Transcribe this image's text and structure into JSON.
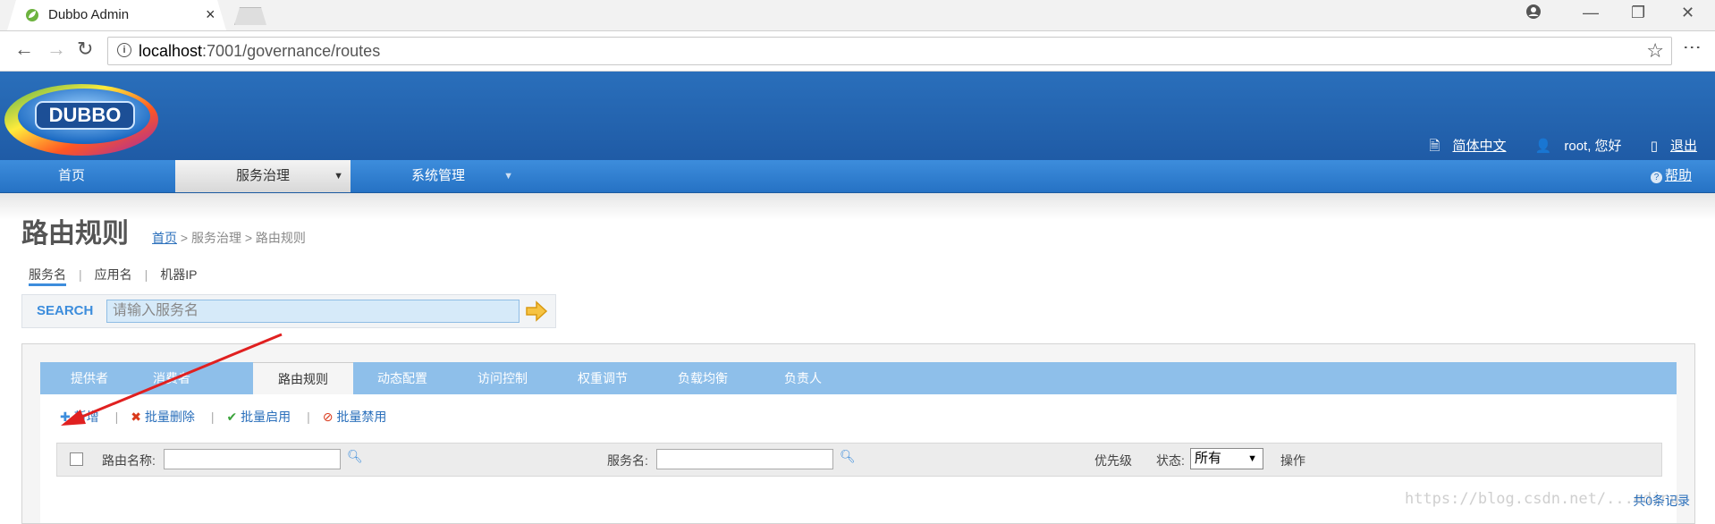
{
  "browser": {
    "tab_title": "Dubbo Admin",
    "url_host": "localhost",
    "url_rest": ":7001/governance/routes"
  },
  "header": {
    "logo_text": "DUBBO",
    "lang": "简体中文",
    "user": "root, 您好",
    "logout": "退出"
  },
  "nav": {
    "items": [
      "首页",
      "服务治理",
      "系统管理"
    ],
    "help": "帮助"
  },
  "page": {
    "title": "路由规则",
    "breadcrumb_home": "首页",
    "breadcrumb_rest": " > 服务治理 > 路由规则"
  },
  "search": {
    "tabs": [
      "服务名",
      "应用名",
      "机器IP"
    ],
    "label": "SEARCH",
    "placeholder": "请输入服务名"
  },
  "subtabs": [
    "提供者",
    "消费者",
    "路由规则",
    "动态配置",
    "访问控制",
    "权重调节",
    "负载均衡",
    "负责人"
  ],
  "actions": {
    "add": "新增",
    "batch_delete": "批量删除",
    "batch_enable": "批量启用",
    "batch_disable": "批量禁用"
  },
  "filter": {
    "route_name_label": "路由名称:",
    "service_label": "服务名:",
    "priority_label": "优先级",
    "status_label": "状态:",
    "status_value": "所有",
    "ops_label": "操作"
  },
  "footer": {
    "count": "共0条记录",
    "watermark": "https://blog.csdn.net/...eding"
  },
  "colors": {
    "header_blue": "#2a6fbb",
    "nav_blue": "#3d8ddc",
    "subtab_blue": "#8ebfea",
    "annotation_red": "#e02020"
  }
}
